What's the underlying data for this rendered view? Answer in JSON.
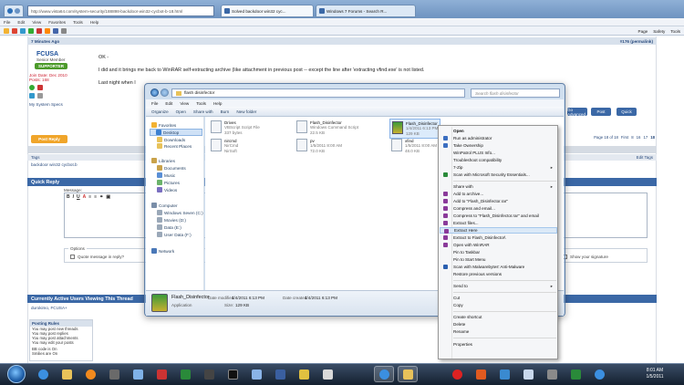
{
  "browser": {
    "address_url": "http://www.vista64.com/system-security/188898-backdoor-win32-cycbot-b-18.html",
    "tabs": [
      {
        "label": "Solved backdoor win32 cyc...",
        "active": true
      },
      {
        "label": "Windows 7 Forums - Search R...",
        "active": false
      }
    ],
    "menu": [
      "File",
      "Edit",
      "View",
      "Favorites",
      "Tools",
      "Help"
    ],
    "cmd_right": [
      "Page",
      "Safety",
      "Tools"
    ]
  },
  "forum": {
    "post_time": "7 Minutes Ago",
    "post_permalink": "#176 (permalink)",
    "username": "FCUSA",
    "user_title": "Senior Member",
    "user_badge": "SUPPORTER",
    "join_date": "Join Date: Dec 2010",
    "posts": "Posts: 168",
    "system_specs": "My System Specs",
    "post_lines": [
      "OK -",
      "I did and it brings me back to WinRAR self-extracting archive (like attachment in previous post -- except the line after 'extracting vfind.exe' is not listed.",
      "Last night when I"
    ],
    "reply_button": "Post Reply",
    "tags_label": "Tags",
    "tags_value": "backdoor win32 cycbot.b",
    "edit_tags": "Edit Tags",
    "quick_reply": "Quick Reply",
    "message_label": "Message:",
    "options_label": "Options",
    "quote_option": "Quote message in reply?",
    "show_signature": "Show your signature",
    "buttons": {
      "go_advanced": "Go Advanced",
      "post": "Post",
      "quick": "Quick"
    },
    "pager": [
      "Page 18 of 18",
      "First",
      "8",
      "16",
      "17",
      "18"
    ],
    "active_users_head": "Currently Active Users Viewing This Thread",
    "active_users": "durokimo, FCUSA+",
    "rules_head": "Posting Rules",
    "rules": [
      "You may post new threads",
      "You may post replies",
      "You may post attachments",
      "You may edit your posts",
      "BB code is On",
      "Smilies are On"
    ]
  },
  "explorer": {
    "path": "flash disinfector",
    "search_placeholder": "Search flash disinfector",
    "menu": [
      "File",
      "Edit",
      "View",
      "Tools",
      "Help"
    ],
    "commands": [
      "Organize",
      "Open",
      "Share with",
      "Burn",
      "New folder"
    ],
    "nav": {
      "favorites": "Favorites",
      "desktop": "Desktop",
      "downloads": "Downloads",
      "recent": "Recent Places",
      "libraries": "Libraries",
      "documents": "Documents",
      "music": "Music",
      "pictures": "Pictures",
      "videos": "Videos",
      "computer": "Computer",
      "drive_c": "Windows Seven (C:)",
      "drive_d": "Movies (D:)",
      "drive_e": "Data (E:)",
      "drive_f": "User Data (F:)",
      "network": "Network"
    },
    "files": [
      {
        "name": "Drives",
        "type": "VBScript Script File",
        "size": "337 bytes"
      },
      {
        "name": "Flash_Disinfector",
        "type": "Windows Command Script",
        "size": "22.5 KB"
      },
      {
        "name": "Flash_Disinfector",
        "type": "1/4/2011 6:13 PM",
        "size": "129 KB"
      },
      {
        "name": "nircmd",
        "type": "NirCmd",
        "size": "NirSoft"
      },
      {
        "name": "pv",
        "type": "1/5/2011 8:00 AM",
        "size": "72.0 KB"
      },
      {
        "name": "xfind",
        "type": "1/5/2011 8:00 AM",
        "size": "48.0 KB"
      }
    ],
    "details": {
      "name": "Flash_Disinfector",
      "kind": "Application",
      "modified_label": "Date modified:",
      "modified": "1/4/2011 6:13 PM",
      "created_label": "Date created:",
      "created": "1/4/2011 6:13 PM",
      "size_label": "Size:",
      "size": "129 KB"
    }
  },
  "context_menu": {
    "items": [
      "Open",
      "Run as administrator",
      "Take Ownership",
      "WinPatrol PLUS Info...",
      "Troubleshoot compatibility",
      "7-Zip",
      "Scan with Microsoft Security Essentials...",
      "Share with",
      "Add to archive...",
      "Add to \"Flash_Disinfector.rar\"",
      "Compress and email...",
      "Compress to \"Flash_Disinfector.rar\" and email",
      "Extract files...",
      "Extract Here",
      "Extract to Flash_Disinfector\\",
      "Open with WinRAR",
      "Pin to Taskbar",
      "Pin to Start Menu",
      "Scan with Malwarebytes' Anti-Malware",
      "Restore previous versions",
      "Send to",
      "Cut",
      "Copy",
      "Create shortcut",
      "Delete",
      "Rename",
      "Properties"
    ]
  },
  "taskbar": {
    "time": "8:01 AM",
    "date": "1/5/2011"
  },
  "colors": {
    "accent": "#3b68a6",
    "highlight": "#dbe9f7",
    "taskbar": "#1c2b3e"
  }
}
